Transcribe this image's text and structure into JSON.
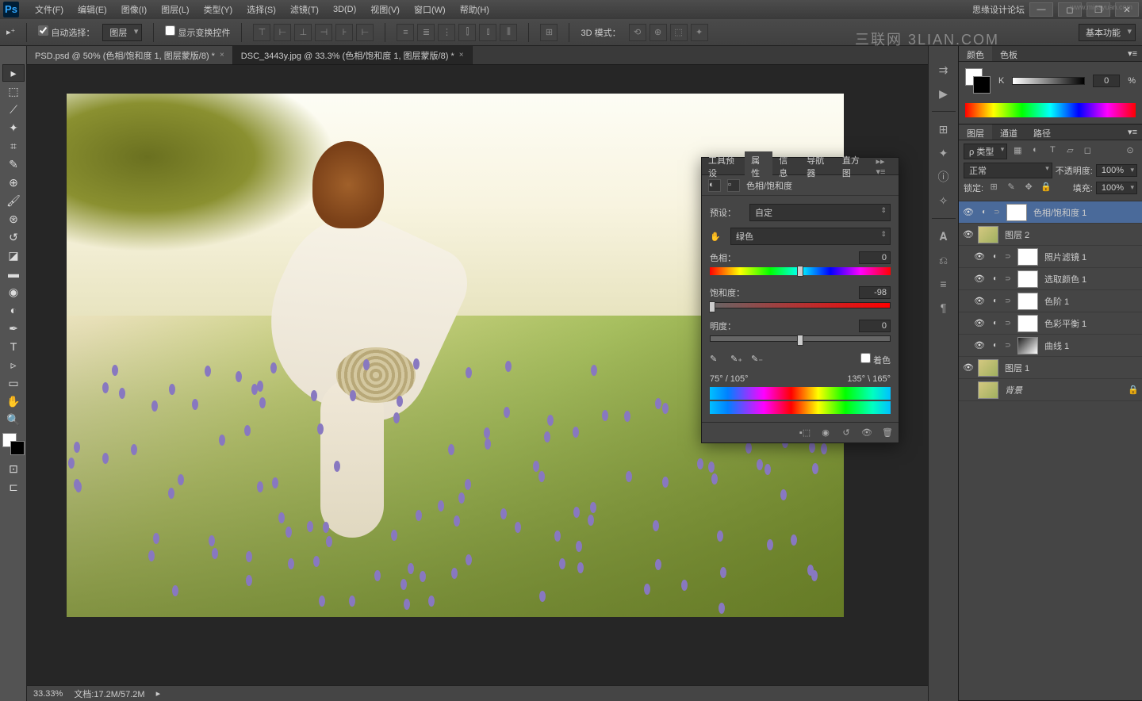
{
  "app": {
    "name": "Ps"
  },
  "menus": [
    "文件(F)",
    "编辑(E)",
    "图像(I)",
    "图层(L)",
    "类型(Y)",
    "选择(S)",
    "滤镜(T)",
    "3D(D)",
    "视图(V)",
    "窗口(W)",
    "帮助(H)"
  ],
  "titleRight": "思缘设计论坛",
  "titleWatermark": "www.missyuan.com",
  "watermark": "三联网  3LIAN.COM",
  "options": {
    "autoSelect": "自动选择：",
    "autoSelectTarget": "图层",
    "showTransform": "显示变换控件",
    "mode3d": "3D 模式：",
    "workspace": "基本功能"
  },
  "tabs": [
    {
      "label": "PSD.psd @ 50% (色相/饱和度 1, 图层蒙版/8) *",
      "active": false
    },
    {
      "label": "DSC_3443y.jpg @ 33.3% (色相/饱和度 1, 图层蒙版/8) *",
      "active": true
    }
  ],
  "status": {
    "zoom": "33.33%",
    "doc": "文档:17.2M/57.2M"
  },
  "propPanel": {
    "tabs": [
      "工具预设",
      "属性",
      "信息",
      "导航器",
      "直方图"
    ],
    "activeTab": "属性",
    "title": "色相/饱和度",
    "preset_lbl": "预设：",
    "preset": "自定",
    "channel": "绿色",
    "hue_lbl": "色相：",
    "hue": "0",
    "sat_lbl": "饱和度：",
    "sat": "-98",
    "light_lbl": "明度：",
    "light": "0",
    "colorize": "着色",
    "rangeL": "75° / 105°",
    "rangeR": "135° \\ 165°"
  },
  "colorPanel": {
    "tabs": [
      "颜色",
      "色板"
    ],
    "k": "K",
    "kval": "0",
    "pct": "%"
  },
  "layersPanel": {
    "tabs": [
      "图层",
      "通道",
      "路径"
    ],
    "kind": "ρ 类型",
    "blend": "正常",
    "opacity_lbl": "不透明度:",
    "opacity": "100%",
    "lock": "锁定:",
    "fill_lbl": "填充:",
    "fill": "100%",
    "layers": [
      {
        "name": "色相/饱和度 1",
        "eye": true,
        "adj": true,
        "mask": true,
        "sel": true,
        "indent": false
      },
      {
        "name": "图层 2",
        "eye": true,
        "photo": true,
        "indent": false
      },
      {
        "name": "照片滤镜 1",
        "eye": true,
        "adj": true,
        "mask": true,
        "indent": true
      },
      {
        "name": "选取颜色 1",
        "eye": true,
        "adj": true,
        "mask": true,
        "indent": true
      },
      {
        "name": "色阶 1",
        "eye": true,
        "adj": true,
        "mask": true,
        "indent": true
      },
      {
        "name": "色彩平衡 1",
        "eye": true,
        "adj": true,
        "mask": true,
        "indent": true
      },
      {
        "name": "曲线 1",
        "eye": true,
        "adj": true,
        "curve": true,
        "indent": true
      },
      {
        "name": "图层 1",
        "eye": true,
        "photo": true,
        "indent": false
      },
      {
        "name": "背景",
        "eye": false,
        "photo": true,
        "lock": true,
        "italic": true,
        "indent": false
      }
    ]
  },
  "dock": [
    "⇉",
    "▶",
    "⊞",
    "✦",
    "ⓘ",
    "✧",
    "𝐀",
    "⎌",
    "≡",
    "¶"
  ]
}
